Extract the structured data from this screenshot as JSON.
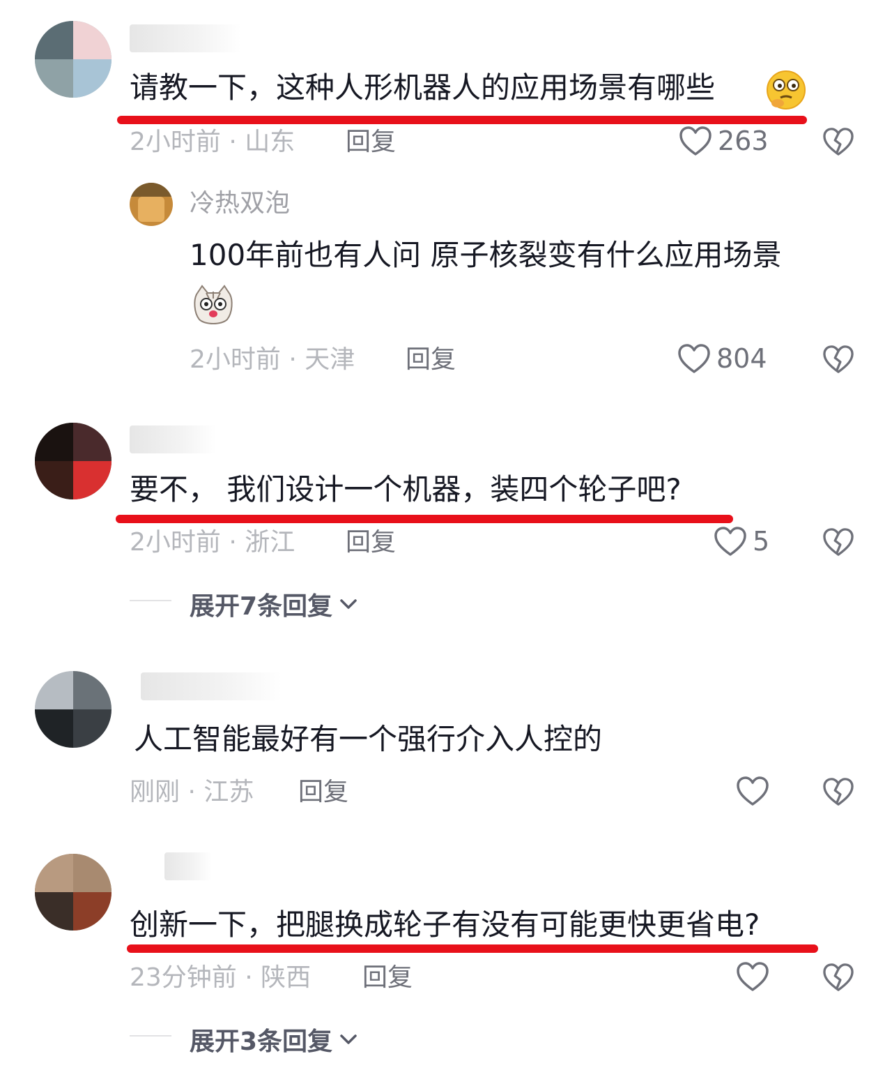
{
  "comments": [
    {
      "text": "请教一下，这种人形机器人的应用场景有哪些",
      "time": "2小时前 · 山东",
      "reply": "回复",
      "likes": "263",
      "reply_comment": {
        "username": "冷热双泡",
        "text": "100年前也有人问 原子核裂变有什么应用场景",
        "time": "2小时前 · 天津",
        "reply": "回复",
        "likes": "804"
      }
    },
    {
      "text": "要不， 我们设计一个机器，装四个轮子吧?",
      "time": "2小时前 · 浙江",
      "reply": "回复",
      "likes": "5",
      "expand": "展开7条回复"
    },
    {
      "text": "人工智能最好有一个强行介入人控的",
      "time": "刚刚 · 江苏",
      "reply": "回复",
      "likes": ""
    },
    {
      "text": "创新一下，把腿换成轮子有没有可能更快更省电?",
      "time": "23分钟前 · 陕西",
      "reply": "回复",
      "likes": "",
      "expand": "展开3条回复"
    }
  ],
  "icons": {
    "like": "heart-outline-icon",
    "dislike": "broken-heart-icon",
    "expand": "chevron-down-icon"
  },
  "colors": {
    "highlight": "#e8101a",
    "meta": "#b4b6bb",
    "action": "#6e7079"
  }
}
